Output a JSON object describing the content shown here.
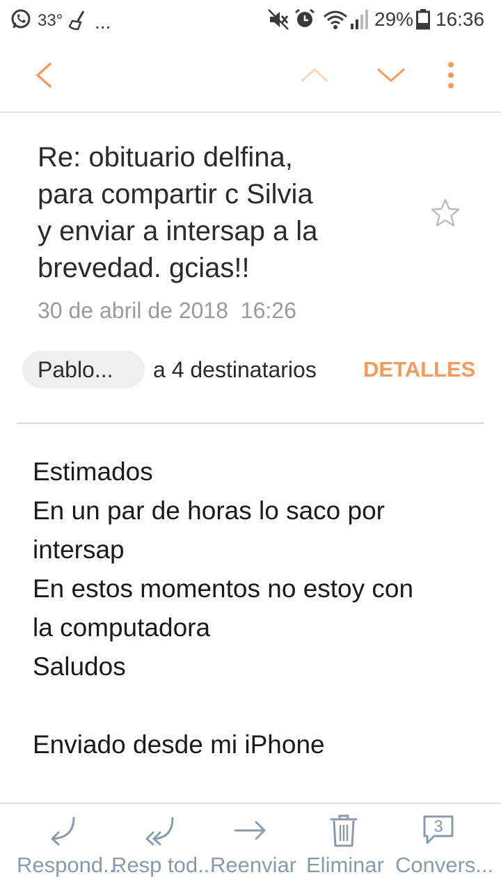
{
  "status_bar": {
    "temperature": "33°",
    "more": "...",
    "battery": "29%",
    "time": "16:36",
    "icons": [
      "whatsapp-icon",
      "broom-icon",
      "mute-icon",
      "alarm-icon",
      "wifi-icon",
      "signal-icon",
      "battery-icon"
    ]
  },
  "toolbar": {
    "icons": [
      "back-icon",
      "previous-icon",
      "next-icon",
      "more-icon"
    ],
    "accent": "#f39a5e",
    "accent_disabled": "#f8d6bf"
  },
  "email": {
    "subject_lines": [
      "Re: obituario delfina,",
      "para compartir c Silvia",
      "y enviar a intersap a la",
      "brevedad. gcias!!"
    ],
    "date": "30 de abril de 2018  16:26",
    "sender": "Pablo...",
    "recipients": "a 4 destinatarios",
    "details_label": "DETALLES",
    "body_lines": [
      "Estimados",
      "En un par de horas lo saco por",
      "intersap",
      "En estos momentos no estoy con",
      "la computadora",
      "Saludos",
      "",
      "Enviado desde mi iPhone"
    ]
  },
  "bottom_bar": {
    "reply": "Respond...",
    "reply_all": "Resp tod...",
    "forward": "Reenviar",
    "delete": "Eliminar",
    "conversation": "Convers...",
    "conversation_count": "3",
    "icon_color": "#8a9aa8"
  }
}
